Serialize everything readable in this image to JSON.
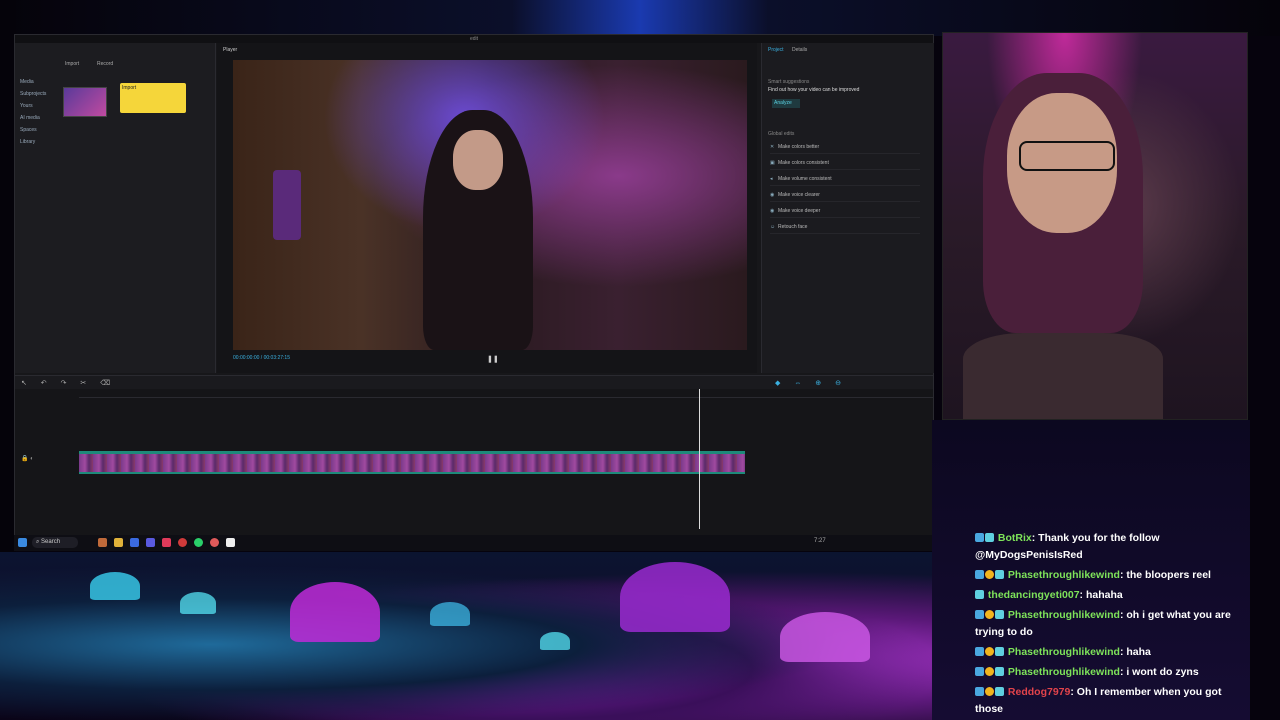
{
  "editor": {
    "window_title": "edit",
    "player_label": "Player",
    "media_tabs": [
      "Import",
      "Record"
    ],
    "media_nav": [
      "Media",
      "Subprojects",
      "Yours",
      "AI media",
      "Spaces",
      "Library"
    ],
    "tooltip": "Import",
    "timecode": "00:00:00:00 / 00:03:27:15",
    "right_tabs": [
      "Project",
      "Details"
    ],
    "smart_suggestions_heading": "Smart suggestions",
    "smart_suggestions_text": "Find out how your video can be improved",
    "analyze_button": "Analyze",
    "global_edits_heading": "Global edits",
    "global_edits": [
      "Make colors better",
      "Make colors consistent",
      "Make volume consistent",
      "Make voice clearer",
      "Make voice deeper",
      "Retouch face"
    ]
  },
  "taskbar": {
    "search_label": "Search",
    "clock": "7:27"
  },
  "chat": {
    "messages": [
      {
        "user": "BotRix",
        "user_color": "#7ee35a",
        "text": ": Thank you for the follow @MyDogsPenisIsRed",
        "badges": [
          "b1",
          "b3"
        ]
      },
      {
        "user": "Phasethroughlikewind",
        "user_color": "#7ee35a",
        "text": ": the bloopers reel",
        "badges": [
          "b1",
          "b2",
          "b3"
        ]
      },
      {
        "user": "thedancingyeti007",
        "user_color": "#7ee35a",
        "text": ": hahaha",
        "badges": [
          "b3"
        ]
      },
      {
        "user": "Phasethroughlikewind",
        "user_color": "#7ee35a",
        "text": ": oh i get what you are trying to do",
        "badges": [
          "b1",
          "b2",
          "b3"
        ]
      },
      {
        "user": "Phasethroughlikewind",
        "user_color": "#7ee35a",
        "text": ": haha",
        "badges": [
          "b1",
          "b2",
          "b3"
        ]
      },
      {
        "user": "Phasethroughlikewind",
        "user_color": "#7ee35a",
        "text": ": i wont do zyns",
        "badges": [
          "b1",
          "b2",
          "b3"
        ]
      },
      {
        "user": "Reddog7979",
        "user_color": "#e2434b",
        "text": ": Oh I remember when you got those",
        "badges": [
          "b1",
          "b2",
          "b3"
        ]
      }
    ]
  }
}
